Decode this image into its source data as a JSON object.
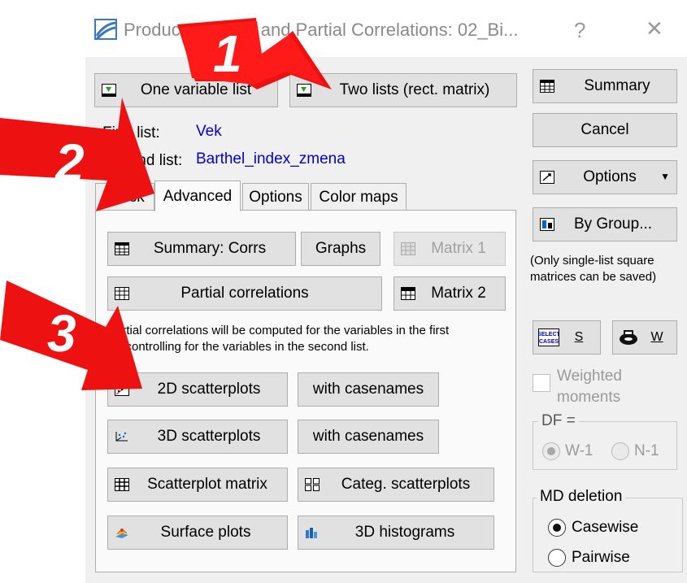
{
  "window": {
    "title": "Product-Moment and Partial Correlations: 02_Bi...",
    "help_glyph": "?",
    "close_glyph": "✕"
  },
  "top_buttons": {
    "one_list": "One variable list",
    "two_lists": "Two lists (rect. matrix)"
  },
  "lists": {
    "first_label": "First list:",
    "first_value": "Vek",
    "second_label": "Second list:",
    "second_value": "Barthel_index_zmena"
  },
  "tabs": [
    "Quick",
    "Advanced",
    "Options",
    "Color maps"
  ],
  "panel": {
    "summary_corrs": "Summary:  Corrs",
    "graphs": "Graphs",
    "matrix1": "Matrix 1",
    "partial_corr": "Partial correlations",
    "matrix2": "Matrix 2",
    "note_line1": "Partial correlations will be computed for the variables in the first",
    "note_line2": "list controlling for the variables in the second list.",
    "scatter2d": "2D scatterplots",
    "with_casenames_1": "with casenames",
    "scatter3d": "3D scatterplots",
    "with_casenames_2": "with casenames",
    "scatter_matrix": "Scatterplot matrix",
    "categ_scatter": "Categ. scatterplots",
    "surface": "Surface plots",
    "hist3d": "3D histograms"
  },
  "right": {
    "summary": "Summary",
    "cancel": "Cancel",
    "options": "Options",
    "by_group": "By Group...",
    "note_line1": "(Only single-list square",
    "note_line2": "matrices can be saved)",
    "s_label": "S",
    "w_label": "W",
    "weighted_line1": "Weighted",
    "weighted_line2": "moments",
    "df_label": "DF =",
    "df_w1": "W-1",
    "df_n1": "N-1",
    "md_label": "MD deletion",
    "casewise": "Casewise",
    "pairwise": "Pairwise"
  },
  "annotations": [
    "1",
    "2",
    "3"
  ],
  "colors": {
    "accent_blue": "#0000d0",
    "arrow_red": "#ee1111"
  }
}
